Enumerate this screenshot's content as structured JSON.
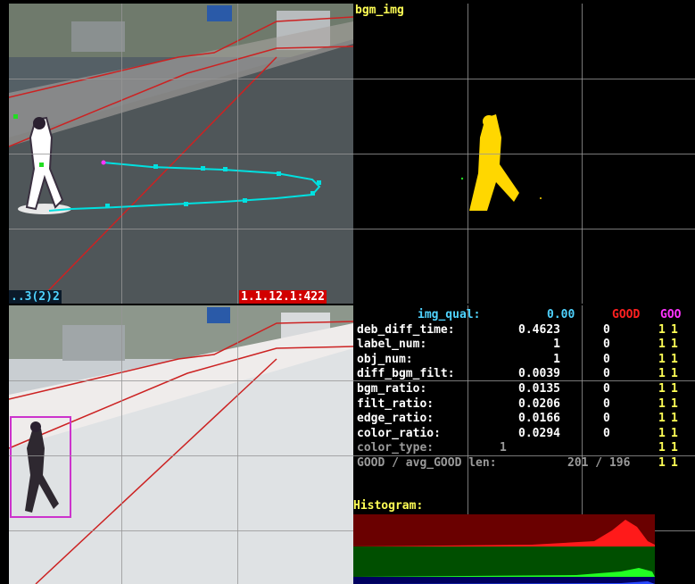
{
  "top_left": {
    "left_label": "..3(2)2",
    "right_label": "1.1.12.1:422"
  },
  "top_right": {
    "title": "bgm_img"
  },
  "stats": {
    "header": {
      "name": "img_qual:",
      "value": "0.00",
      "good": "GOOD",
      "good2": "GOO"
    },
    "rows": [
      {
        "name": "deb_diff_time:",
        "value": "0.4623",
        "flag": "0",
        "g1": "1",
        "g2": "1"
      },
      {
        "name": "label_num:",
        "value": "1",
        "flag": "0",
        "g1": "1",
        "g2": "1"
      },
      {
        "name": "obj_num:",
        "value": "1",
        "flag": "0",
        "g1": "1",
        "g2": "1"
      },
      {
        "name": "diff_bgm_filt:",
        "value": "0.0039",
        "flag": "0",
        "g1": "1",
        "g2": "1"
      },
      {
        "name": "bgm_ratio:",
        "value": "0.0135",
        "flag": "0",
        "g1": "1",
        "g2": "1"
      },
      {
        "name": "filt_ratio:",
        "value": "0.0206",
        "flag": "0",
        "g1": "1",
        "g2": "1"
      },
      {
        "name": "edge_ratio:",
        "value": "0.0166",
        "flag": "0",
        "g1": "1",
        "g2": "1"
      },
      {
        "name": "color_ratio:",
        "value": "0.0294",
        "flag": "0",
        "g1": "1",
        "g2": "1"
      }
    ],
    "color_type": {
      "name": "color_type:",
      "value": "1",
      "g1": "1",
      "g2": "1"
    },
    "good_line": {
      "text": "GOOD / avg_GOOD len:",
      "value": "201 / 196",
      "g1": "1",
      "g2": "1"
    }
  },
  "histogram": {
    "title": "Histogram:"
  },
  "colors": {
    "grid": "#969696",
    "track": "#00e0e0",
    "boundary": "#cc2222",
    "bbox": "#cc33cc",
    "mask": "#ffd700"
  }
}
